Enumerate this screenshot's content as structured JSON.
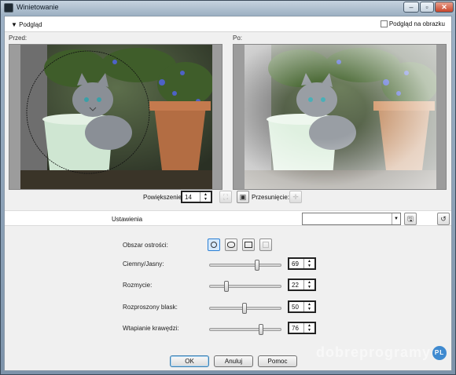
{
  "window": {
    "title": "Winietowanie"
  },
  "preview": {
    "toggle_label": "Podgląd",
    "show_on_image_label": "Podgląd na obrazku",
    "before_label": "Przed:",
    "after_label": "Po:"
  },
  "zoom": {
    "label": "Powiększenie:",
    "value": "14"
  },
  "pan": {
    "label": "Przesunięcie:"
  },
  "presets": {
    "label": "Ustawienia",
    "value": ""
  },
  "settings": {
    "focus_area_label": "Obszar ostrości:",
    "focus_shapes": [
      "circle",
      "ellipse",
      "rectangle",
      "custom"
    ],
    "selected_shape": "circle",
    "rows": [
      {
        "label": "Ciemny/Jasny:",
        "value": "69",
        "level": 0.69
      },
      {
        "label": "Rozmycie:",
        "value": "22",
        "level": 0.22
      },
      {
        "label": "Rozproszony blask:",
        "value": "50",
        "level": 0.5
      },
      {
        "label": "Wtapianie krawędzi:",
        "value": "76",
        "level": 0.76
      }
    ]
  },
  "buttons": {
    "ok": "OK",
    "cancel": "Anuluj",
    "help": "Pomoc"
  },
  "watermark": {
    "text": "dobreprogramy",
    "badge": "PL"
  }
}
